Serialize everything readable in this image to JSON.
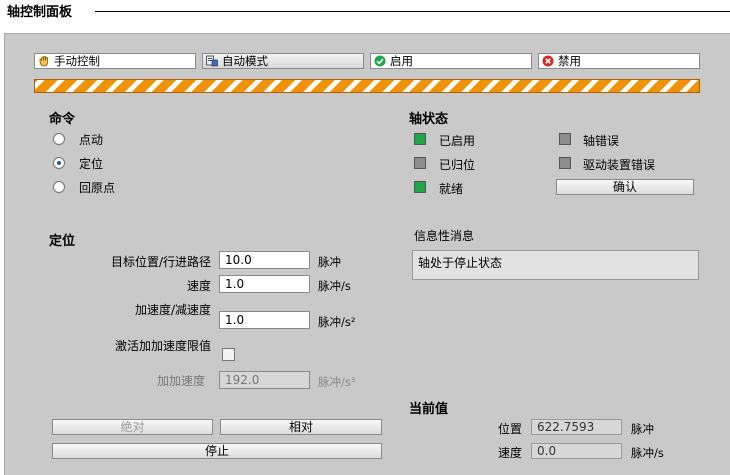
{
  "header": {
    "title": "轴控制面板"
  },
  "mode_bar": {
    "manual": "手动控制",
    "auto": "自动模式",
    "enable": "启用",
    "disable": "禁用"
  },
  "command": {
    "title": "命令",
    "options": [
      "点动",
      "定位",
      "回原点"
    ],
    "selected": "定位"
  },
  "axis_status": {
    "title": "轴状态",
    "items": [
      {
        "label": "已启用",
        "state": "on"
      },
      {
        "label": "已归位",
        "state": "off"
      },
      {
        "label": "就绪",
        "state": "on"
      },
      {
        "label": "轴错误",
        "state": "off"
      },
      {
        "label": "驱动装置错误",
        "state": "off"
      }
    ],
    "ack_button": "确认"
  },
  "positioning": {
    "title": "定位",
    "target_label": "目标位置/行进路径",
    "target_value": "10.0",
    "target_unit": "脉冲",
    "speed_label": "速度",
    "speed_value": "1.0",
    "speed_unit": "脉冲/s",
    "accel_label": "加速度/减速度",
    "accel_value": "1.0",
    "accel_unit": "脉冲/s²",
    "jerk_enable_label": "激活加加速度限值",
    "jerk_label": "加加速度",
    "jerk_value": "192.0",
    "jerk_unit": "脉冲/s³",
    "absolute_button": "绝对",
    "relative_button": "相对",
    "stop_button": "停止"
  },
  "info": {
    "title": "信息性消息",
    "message": "轴处于停止状态"
  },
  "current": {
    "title": "当前值",
    "position_label": "位置",
    "position_value": "622.7593",
    "position_unit": "脉冲",
    "speed_label": "速度",
    "speed_value": "0.0",
    "speed_unit": "脉冲/s"
  },
  "colors": {
    "led_on": "#1fa84a",
    "stripe": "#f39200",
    "panel": "#c9c9c9"
  }
}
